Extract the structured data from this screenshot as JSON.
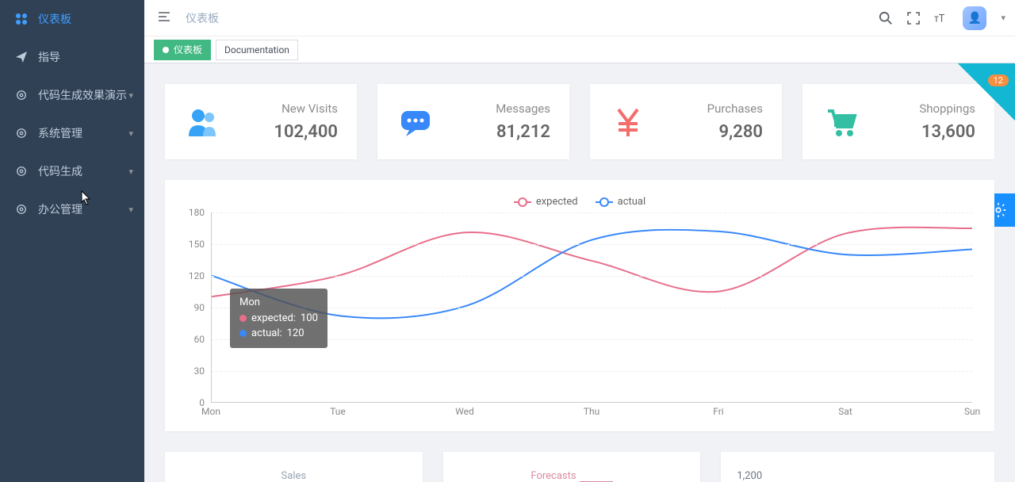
{
  "sidebar": {
    "items": [
      {
        "label": "仪表板",
        "icon": "dashboard",
        "active": true,
        "expandable": false
      },
      {
        "label": "指导",
        "icon": "plane",
        "active": false,
        "expandable": false
      },
      {
        "label": "代码生成效果演示",
        "icon": "gear",
        "active": false,
        "expandable": true
      },
      {
        "label": "系统管理",
        "icon": "gear",
        "active": false,
        "expandable": true
      },
      {
        "label": "代码生成",
        "icon": "gear",
        "active": false,
        "expandable": true
      },
      {
        "label": "办公管理",
        "icon": "gear",
        "active": false,
        "expandable": true
      }
    ]
  },
  "header": {
    "breadcrumb": "仪表板"
  },
  "tabs": [
    {
      "label": "仪表板",
      "active": true
    },
    {
      "label": "Documentation",
      "active": false
    }
  ],
  "corner_badge": "12",
  "stats": [
    {
      "title": "New Visits",
      "value": "102,400",
      "icon": "people",
      "color": "#36a3f7"
    },
    {
      "title": "Messages",
      "value": "81,212",
      "icon": "chat",
      "color": "#3888fa"
    },
    {
      "title": "Purchases",
      "value": "9,280",
      "icon": "yen",
      "color": "#f56c6c"
    },
    {
      "title": "Shoppings",
      "value": "13,600",
      "icon": "cart",
      "color": "#34bfa3"
    }
  ],
  "chart_data": {
    "type": "line",
    "x": [
      "Mon",
      "Tue",
      "Wed",
      "Thu",
      "Fri",
      "Sat",
      "Sun"
    ],
    "series": [
      {
        "name": "expected",
        "values": [
          100,
          120,
          161,
          134,
          105,
          160,
          165
        ],
        "color": "#e86e8a"
      },
      {
        "name": "actual",
        "values": [
          120,
          82,
          91,
          154,
          162,
          140,
          145
        ],
        "color": "#3888fa"
      }
    ],
    "ylim": [
      0,
      180
    ],
    "yticks": [
      0,
      30,
      60,
      90,
      120,
      150,
      180
    ],
    "legend": [
      "expected",
      "actual"
    ],
    "tooltip": {
      "x": "Mon",
      "expected": 100,
      "actual": 120
    }
  },
  "bottom_panels": {
    "p1": "Sales",
    "p2": "Forecasts",
    "p3": "1,200"
  },
  "tooltip_labels": {
    "expected": "expected:",
    "actual": "actual:"
  }
}
